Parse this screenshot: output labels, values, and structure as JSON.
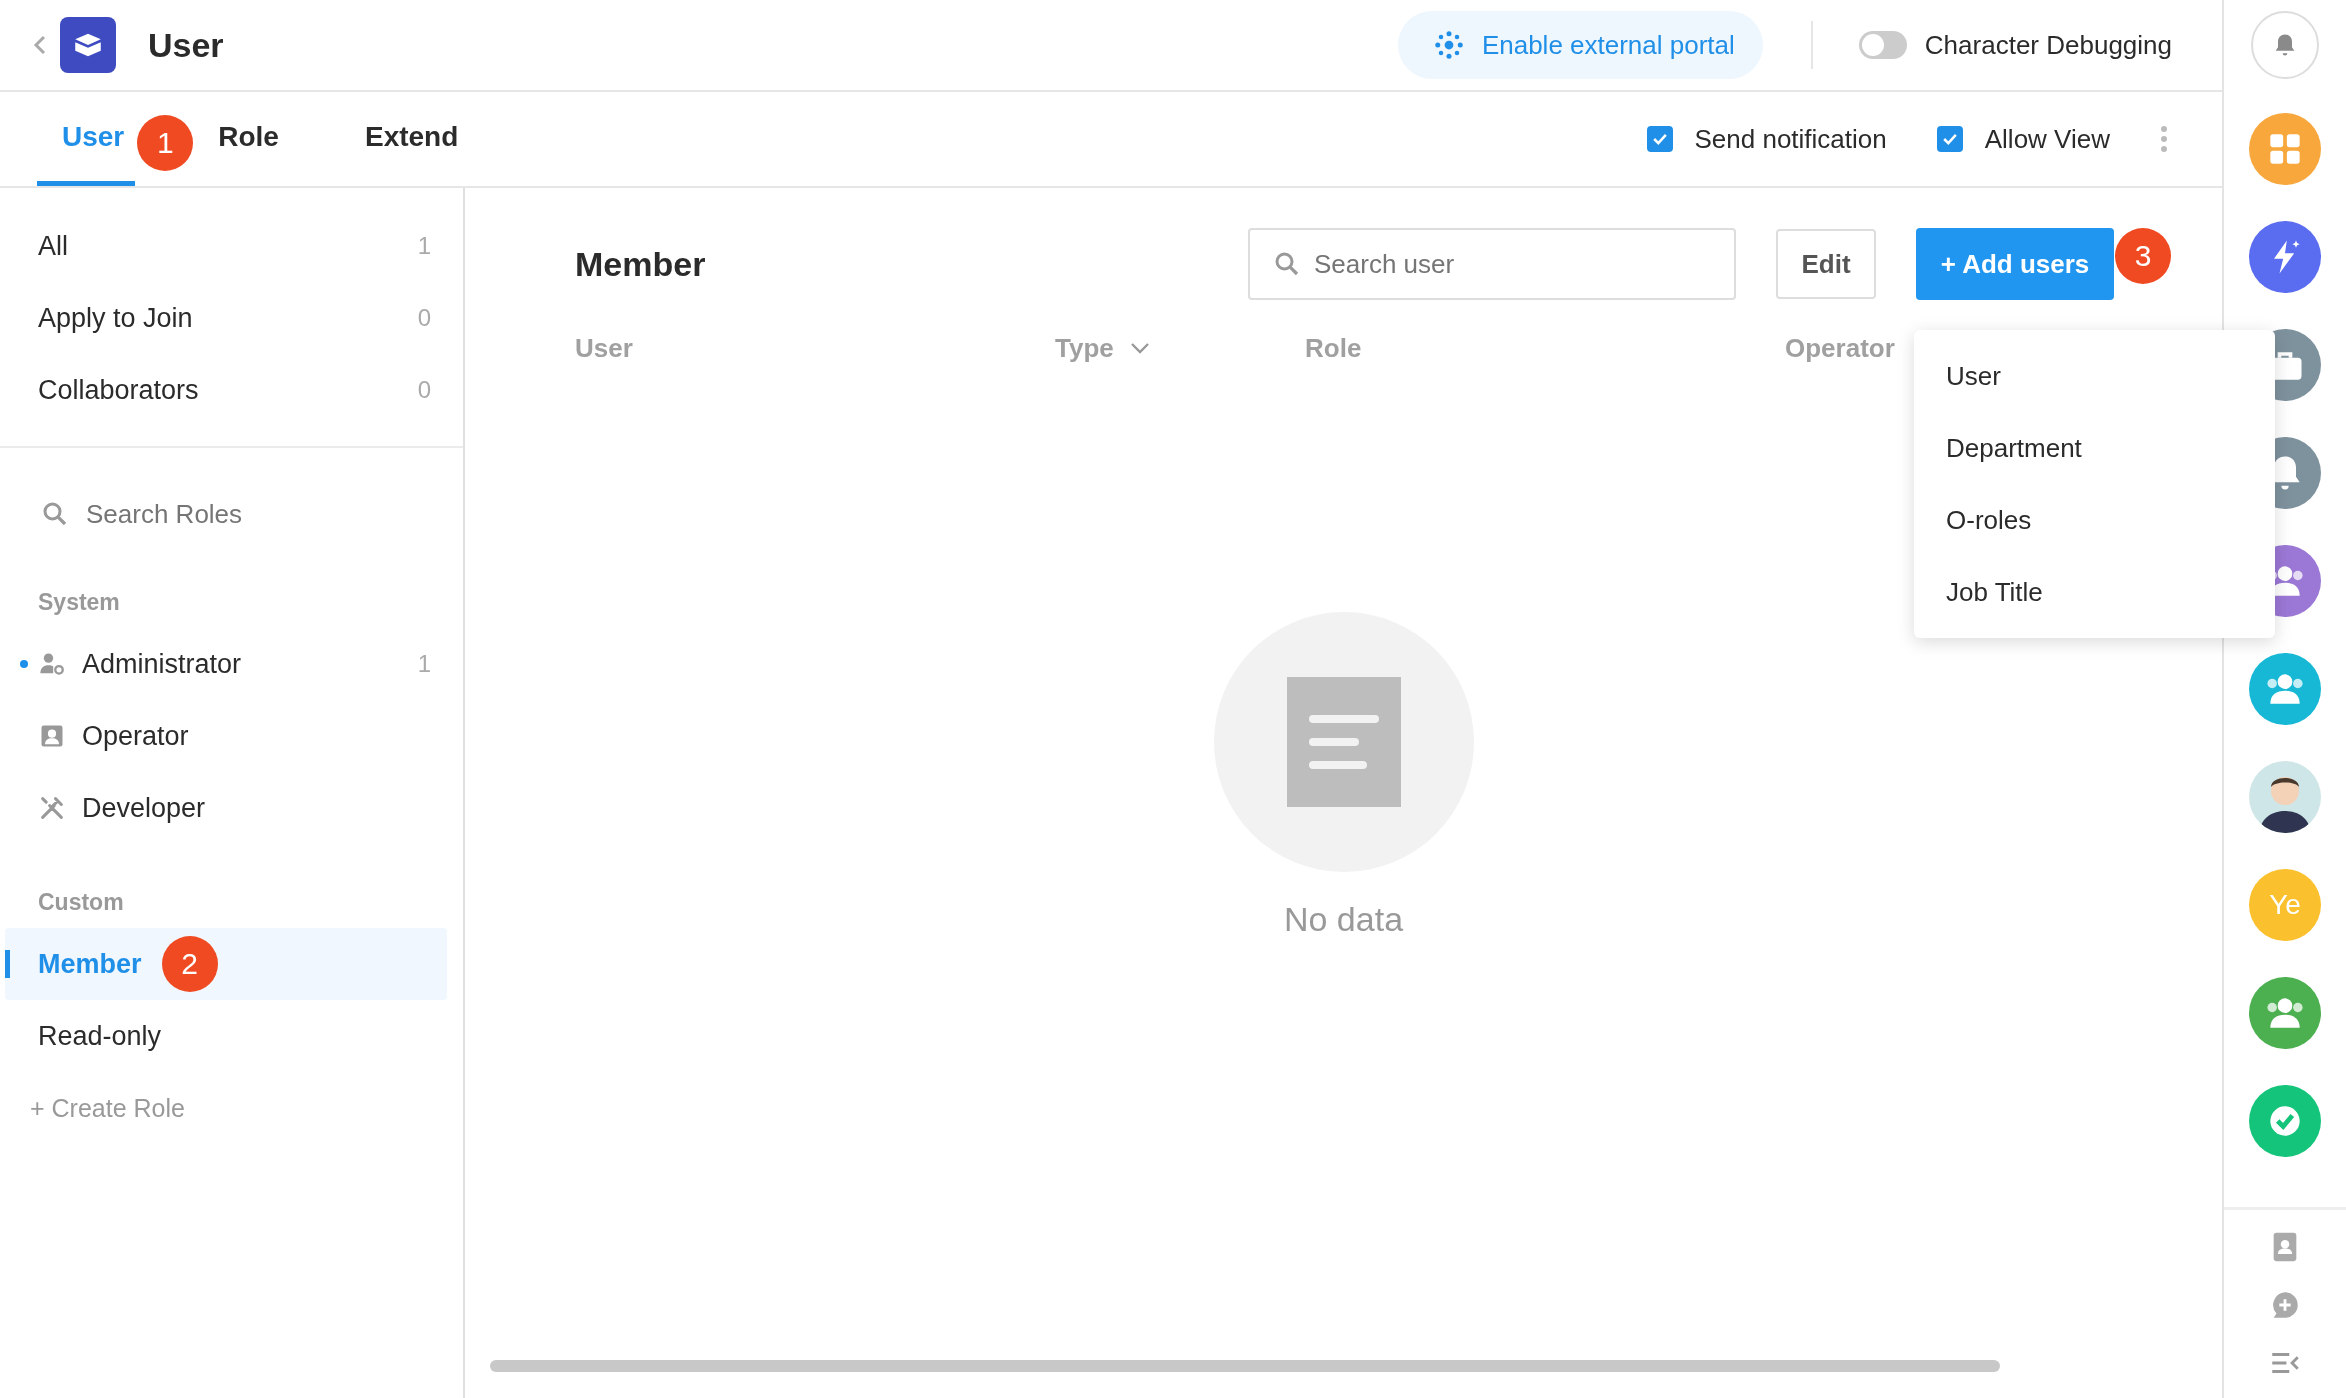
{
  "header": {
    "title": "User",
    "portal_button": "Enable external portal",
    "debug_toggle": {
      "label": "Character Debugging",
      "on": false
    }
  },
  "tabs": [
    {
      "label": "User",
      "selected": true,
      "badge": "1"
    },
    {
      "label": "Role",
      "selected": false
    },
    {
      "label": "Extend",
      "selected": false
    }
  ],
  "options": [
    {
      "label": "Send notification",
      "checked": true
    },
    {
      "label": "Allow View",
      "checked": true
    }
  ],
  "sidebar": {
    "filters": [
      {
        "label": "All",
        "count": "1"
      },
      {
        "label": "Apply to Join",
        "count": "0"
      },
      {
        "label": "Collaborators",
        "count": "0"
      }
    ],
    "search": {
      "placeholder": "Search Roles"
    },
    "groups": [
      {
        "title": "System",
        "roles": [
          {
            "label": "Administrator",
            "count": "1",
            "dot": true,
            "selected": false
          },
          {
            "label": "Operator",
            "dot": false,
            "selected": false
          },
          {
            "label": "Developer",
            "dot": false,
            "selected": false
          }
        ]
      },
      {
        "title": "Custom",
        "roles": [
          {
            "label": "Member",
            "dot": false,
            "selected": true,
            "badge": "2"
          },
          {
            "label": "Read-only",
            "dot": false,
            "selected": false
          }
        ]
      }
    ],
    "create_role": "+ Create Role"
  },
  "content": {
    "title": "Member",
    "search": {
      "placeholder": "Search user"
    },
    "edit_button": "Edit",
    "add_button": "+ Add users",
    "add_badge": "3",
    "columns": [
      {
        "label": "User",
        "dropdown": false
      },
      {
        "label": "Type",
        "dropdown": true
      },
      {
        "label": "Role",
        "dropdown": false
      },
      {
        "label": "Operator",
        "dropdown": false
      }
    ],
    "empty": "No data",
    "menu": [
      "User",
      "Department",
      "O-roles",
      "Job Title"
    ]
  },
  "dock": {
    "items": [
      {
        "kind": "outline"
      },
      {
        "kind": "icon",
        "color": "#f7a73b"
      },
      {
        "kind": "icon",
        "color": "#5a6cf0"
      },
      {
        "kind": "icon",
        "color": "#7e929e"
      },
      {
        "kind": "icon",
        "color": "#7e929e"
      },
      {
        "kind": "icon",
        "color": "#9b78d6"
      },
      {
        "kind": "icon",
        "color": "#16b8d6"
      },
      {
        "kind": "avatar",
        "color": "#cfe6e8"
      },
      {
        "kind": "text",
        "color": "#fbc02d",
        "label": "Ye"
      },
      {
        "kind": "icon",
        "color": "#4caf50"
      },
      {
        "kind": "icon",
        "color": "#14c47a"
      }
    ]
  }
}
